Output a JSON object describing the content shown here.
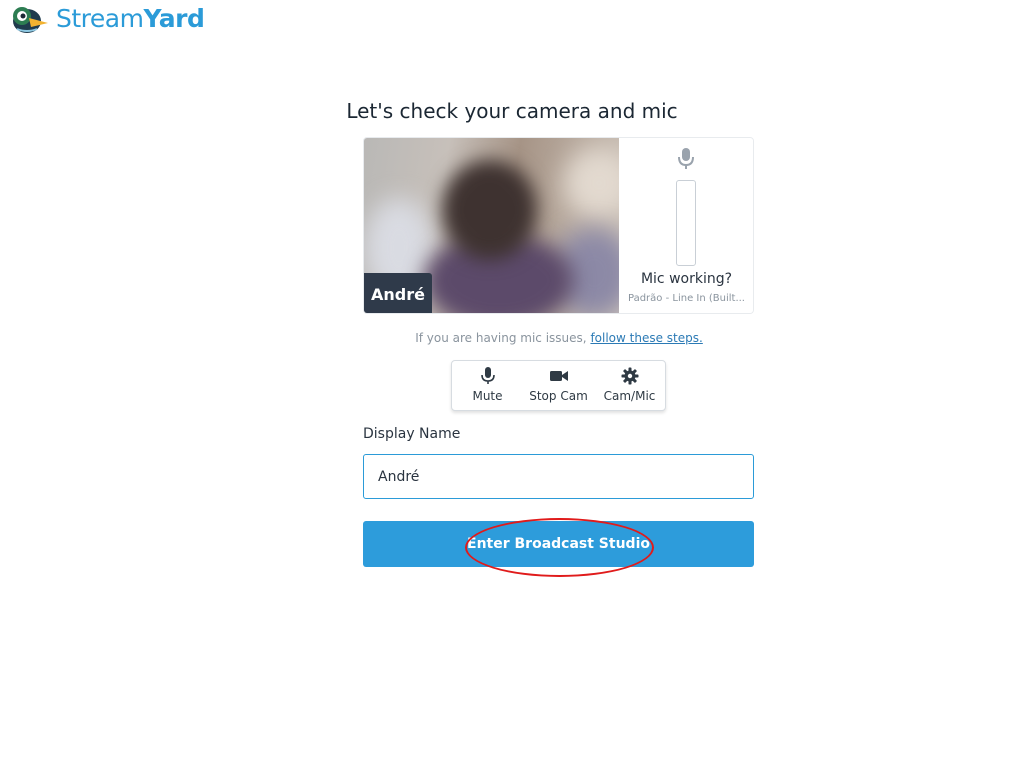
{
  "app": {
    "name_light": "Stream",
    "name_bold": "Yard"
  },
  "title": "Let's check your camera and mic",
  "preview": {
    "participant_name": "André",
    "mic_status": "Mic working?",
    "mic_device": "Padrão - Line In (Built..."
  },
  "help": {
    "text": "If you are having mic issues, ",
    "link": "follow these steps."
  },
  "controls": [
    {
      "label": "Mute",
      "icon": "microphone-icon"
    },
    {
      "label": "Stop Cam",
      "icon": "video-camera-icon"
    },
    {
      "label": "Cam/Mic",
      "icon": "gear-icon"
    }
  ],
  "display_name": {
    "label": "Display Name",
    "value": "André"
  },
  "enter_button": "Enter Broadcast Studio",
  "colors": {
    "brand": "#2b9bd8",
    "button": "#2d9cdb",
    "annotation": "#e01b1b"
  }
}
